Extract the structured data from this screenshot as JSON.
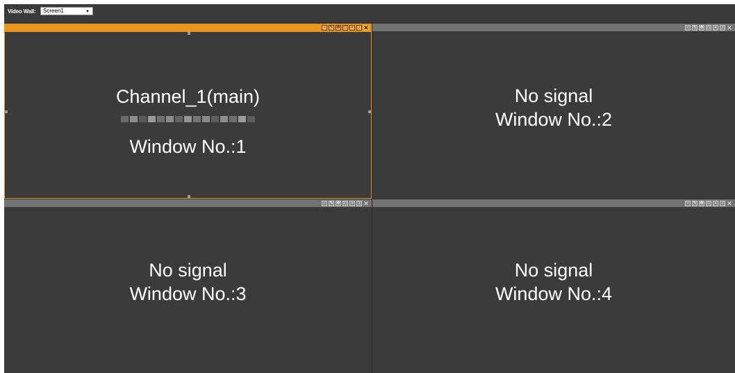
{
  "toolbar": {
    "label": "Video Wall:",
    "screen_value": "Screen1"
  },
  "windows": [
    {
      "line1": "Channel_1(main)",
      "line3": "Window No.:1",
      "active": true
    },
    {
      "line1": "No signal",
      "line2": "Window No.:2"
    },
    {
      "line1": "No signal",
      "line2": "Window No.:3"
    },
    {
      "line1": "No signal",
      "line2": "Window No.:4"
    }
  ],
  "window_tools": [
    "capture-icon",
    "edit-icon",
    "move-icon",
    "maximize-icon",
    "lock-icon",
    "audio-icon",
    "close-icon"
  ],
  "colors": {
    "active_accent": "#e9961e",
    "inactive_titlebar": "#737373",
    "background": "#3b3b3b"
  }
}
